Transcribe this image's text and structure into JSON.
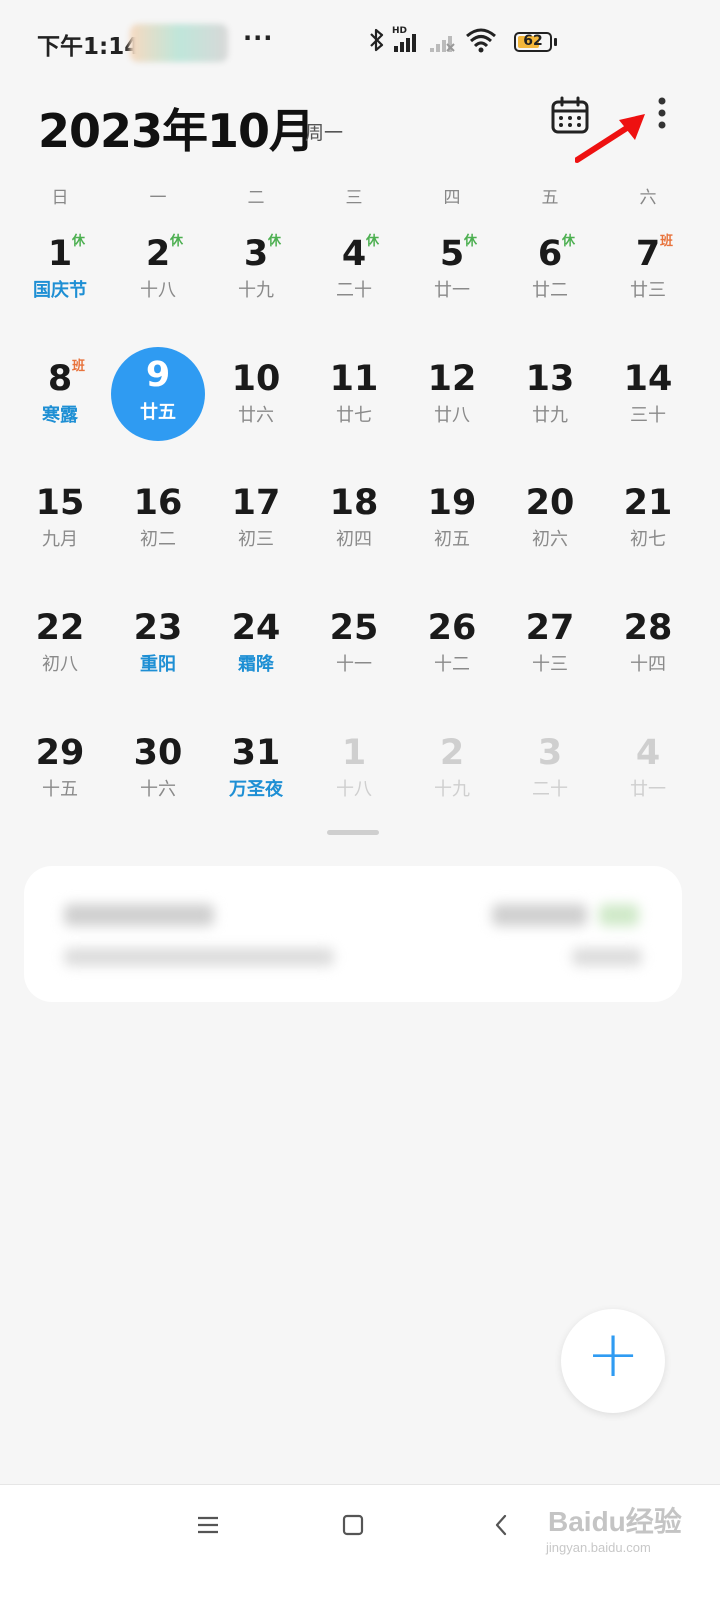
{
  "status_bar": {
    "time": "下午1:14",
    "more": "···",
    "network_label": "HD",
    "battery": "62"
  },
  "header": {
    "title": "2023年10月",
    "weekday": "周一",
    "calendar_icon": "calendar-icon",
    "more_icon": "more-vertical-icon"
  },
  "weekdays": [
    "日",
    "一",
    "二",
    "三",
    "四",
    "五",
    "六"
  ],
  "days": [
    {
      "d": "1",
      "sub": "国庆节",
      "festival": true,
      "tag": "休"
    },
    {
      "d": "2",
      "sub": "十八",
      "tag": "休"
    },
    {
      "d": "3",
      "sub": "十九",
      "tag": "休"
    },
    {
      "d": "4",
      "sub": "二十",
      "tag": "休"
    },
    {
      "d": "5",
      "sub": "廿一",
      "tag": "休"
    },
    {
      "d": "6",
      "sub": "廿二",
      "tag": "休"
    },
    {
      "d": "7",
      "sub": "廿三",
      "tag": "班"
    },
    {
      "d": "8",
      "sub": "寒露",
      "festival": true,
      "tag": "班"
    },
    {
      "d": "9",
      "sub": "廿五",
      "today": true
    },
    {
      "d": "10",
      "sub": "廿六"
    },
    {
      "d": "11",
      "sub": "廿七"
    },
    {
      "d": "12",
      "sub": "廿八"
    },
    {
      "d": "13",
      "sub": "廿九"
    },
    {
      "d": "14",
      "sub": "三十"
    },
    {
      "d": "15",
      "sub": "九月"
    },
    {
      "d": "16",
      "sub": "初二"
    },
    {
      "d": "17",
      "sub": "初三"
    },
    {
      "d": "18",
      "sub": "初四"
    },
    {
      "d": "19",
      "sub": "初五"
    },
    {
      "d": "20",
      "sub": "初六"
    },
    {
      "d": "21",
      "sub": "初七"
    },
    {
      "d": "22",
      "sub": "初八"
    },
    {
      "d": "23",
      "sub": "重阳",
      "festival": true
    },
    {
      "d": "24",
      "sub": "霜降",
      "festival": true
    },
    {
      "d": "25",
      "sub": "十一"
    },
    {
      "d": "26",
      "sub": "十二"
    },
    {
      "d": "27",
      "sub": "十三"
    },
    {
      "d": "28",
      "sub": "十四"
    },
    {
      "d": "29",
      "sub": "十五"
    },
    {
      "d": "30",
      "sub": "十六"
    },
    {
      "d": "31",
      "sub": "万圣夜",
      "festival": true
    },
    {
      "d": "1",
      "sub": "十八",
      "other": true
    },
    {
      "d": "2",
      "sub": "十九",
      "other": true
    },
    {
      "d": "3",
      "sub": "二十",
      "other": true
    },
    {
      "d": "4",
      "sub": "廿一",
      "other": true
    }
  ],
  "fab": {
    "label": "+"
  },
  "colors": {
    "accent": "#2f9bf2",
    "festival": "#1e8fd4",
    "rest": "#4caf50",
    "work": "#e8733c"
  },
  "nav": {
    "menu_icon": "menu-icon",
    "home_icon": "home-icon",
    "back_icon": "back-icon"
  },
  "watermark": {
    "text": "Baidu经验",
    "sub": "jingyan.baidu.com"
  }
}
